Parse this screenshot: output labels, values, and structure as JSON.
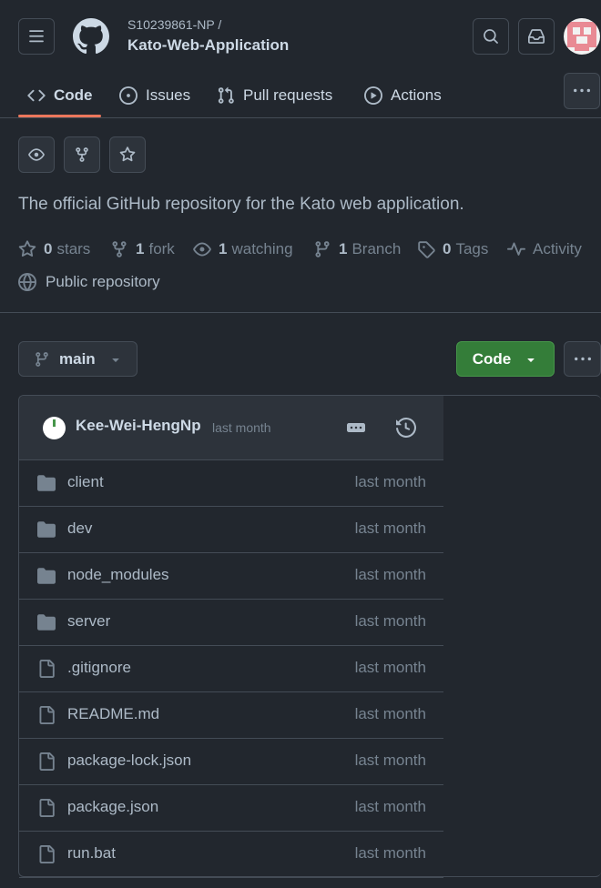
{
  "header": {
    "owner": "S10239861-NP /",
    "repo": "Kato-Web-Application"
  },
  "tabs": [
    {
      "label": "Code",
      "icon": "code-icon"
    },
    {
      "label": "Issues",
      "icon": "issue-opened-icon"
    },
    {
      "label": "Pull requests",
      "icon": "git-pull-request-icon"
    },
    {
      "label": "Actions",
      "icon": "play-icon"
    }
  ],
  "repo_info": {
    "description": "The official GitHub repository for the Kato web application.",
    "stars": {
      "count": "0",
      "label": "stars"
    },
    "forks": {
      "count": "1",
      "label": "fork"
    },
    "watching": {
      "count": "1",
      "label": "watching"
    },
    "branches": {
      "count": "1",
      "label": "Branch"
    },
    "tags": {
      "count": "0",
      "label": "Tags"
    },
    "activity": "Activity",
    "visibility": "Public repository"
  },
  "toolbar": {
    "branch": "main",
    "code_button": "Code"
  },
  "commit": {
    "author": "Kee-Wei-HengNp",
    "time": "last month"
  },
  "files": [
    {
      "name": "client",
      "type": "folder",
      "time": "last month"
    },
    {
      "name": "dev",
      "type": "folder",
      "time": "last month"
    },
    {
      "name": "node_modules",
      "type": "folder",
      "time": "last month"
    },
    {
      "name": "server",
      "type": "folder",
      "time": "last month"
    },
    {
      "name": ".gitignore",
      "type": "file",
      "time": "last month"
    },
    {
      "name": "README.md",
      "type": "file",
      "time": "last month"
    },
    {
      "name": "package-lock.json",
      "type": "file",
      "time": "last month"
    },
    {
      "name": "package.json",
      "type": "file",
      "time": "last month"
    },
    {
      "name": "run.bat",
      "type": "file",
      "time": "last month"
    }
  ],
  "colors": {
    "background": "#22272e",
    "accent_underline": "#ec775c",
    "code_button": "#347d39"
  }
}
